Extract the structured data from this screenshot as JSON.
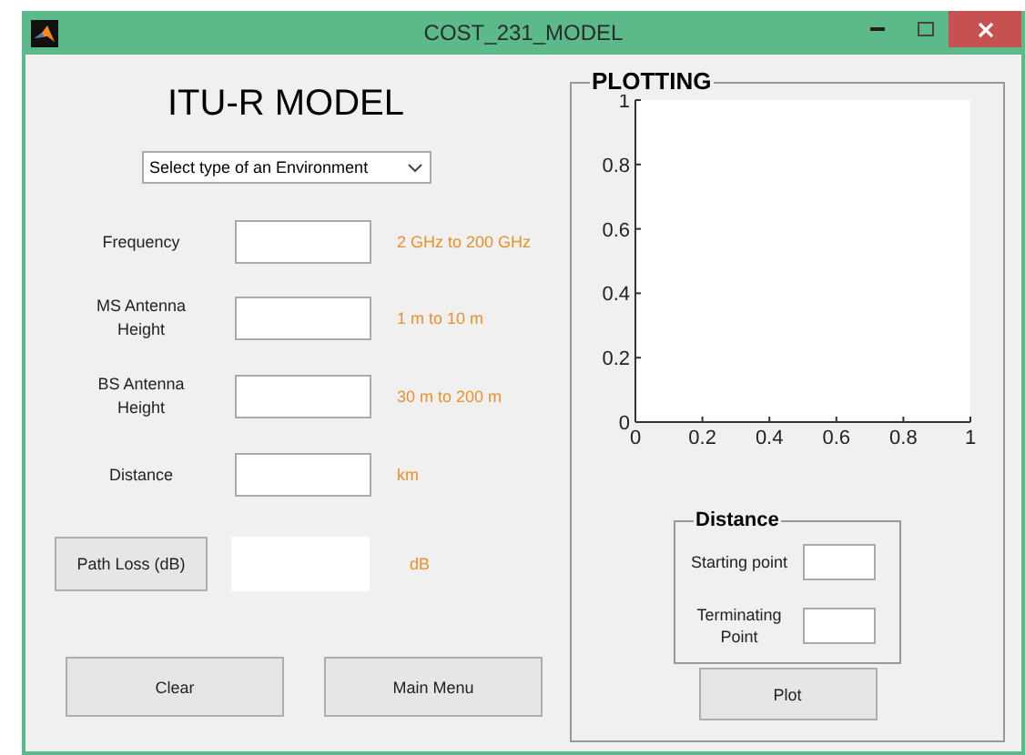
{
  "window": {
    "title": "COST_231_MODEL"
  },
  "heading": "ITU-R MODEL",
  "environment_select": {
    "value": "Select type of an Environment"
  },
  "fields": [
    {
      "label": "Frequency",
      "hint": "2 GHz to 200 GHz"
    },
    {
      "label": "MS Antenna Height",
      "hint": "1 m to 10 m"
    },
    {
      "label": "BS Antenna Height",
      "hint": "30 m to 200 m"
    },
    {
      "label": "Distance",
      "hint": "km"
    }
  ],
  "path_loss": {
    "button": "Path Loss (dB)",
    "unit": "dB"
  },
  "buttons": [
    "Clear",
    "Main Menu"
  ],
  "plotting": {
    "title": "PLOTTING",
    "chart_data": {
      "type": "line",
      "xlim": [
        0,
        1
      ],
      "ylim": [
        0,
        1
      ],
      "xticks": [
        0,
        0.2,
        0.4,
        0.6,
        0.8,
        1
      ],
      "yticks": [
        0,
        0.2,
        0.4,
        0.6,
        0.8,
        1
      ]
    },
    "distance": {
      "title": "Distance",
      "fields": [
        "Starting point",
        "Terminating Point"
      ]
    },
    "plot_button": "Plot"
  }
}
